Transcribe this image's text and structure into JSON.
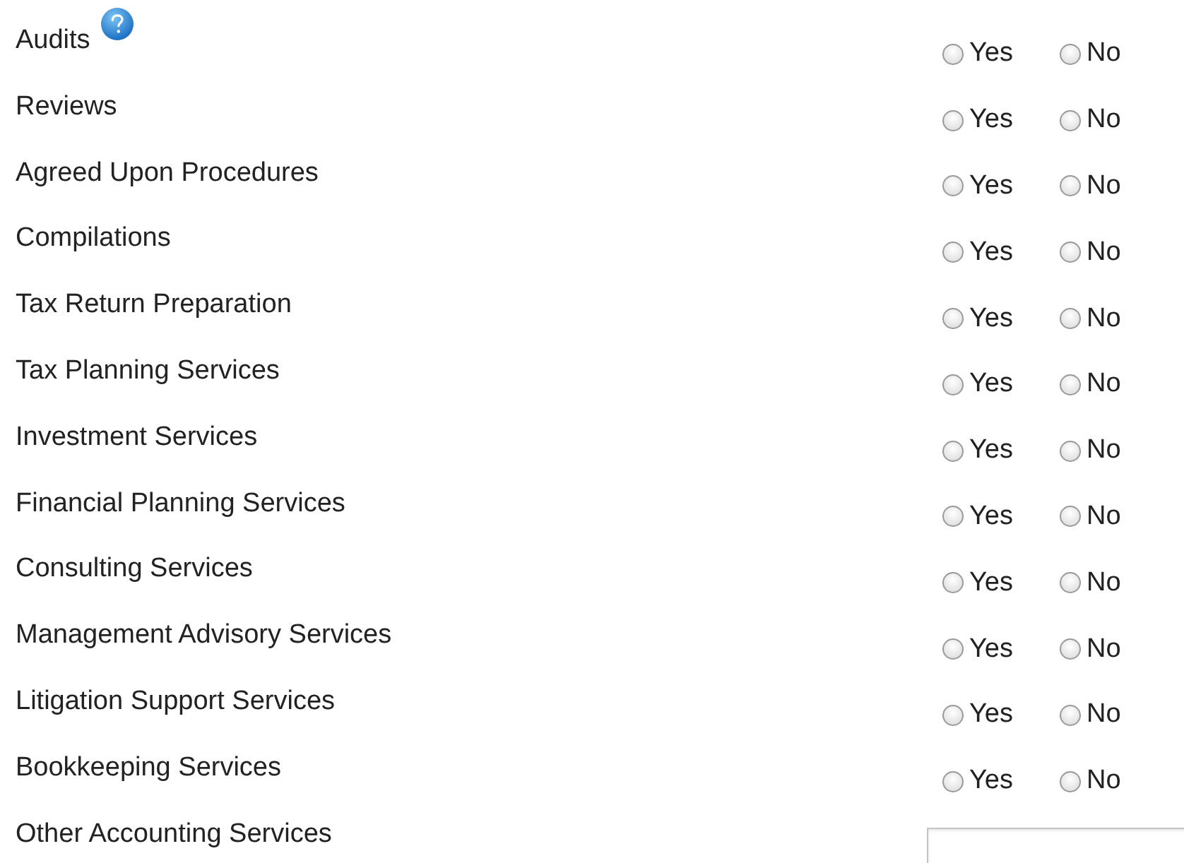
{
  "rows": [
    {
      "kind": "yes_no",
      "label": "Audits",
      "help": true,
      "options": [
        {
          "label": "Yes",
          "selected": false
        },
        {
          "label": "No",
          "selected": false
        }
      ]
    },
    {
      "kind": "yes_no",
      "label": "Reviews",
      "options": [
        {
          "label": "Yes",
          "selected": false
        },
        {
          "label": "No",
          "selected": false
        }
      ]
    },
    {
      "kind": "yes_no",
      "label": "Agreed Upon Procedures",
      "options": [
        {
          "label": "Yes",
          "selected": false
        },
        {
          "label": "No",
          "selected": false
        }
      ]
    },
    {
      "kind": "yes_no",
      "label": "Compilations",
      "options": [
        {
          "label": "Yes",
          "selected": false
        },
        {
          "label": "No",
          "selected": false
        }
      ]
    },
    {
      "kind": "yes_no",
      "label": "Tax Return Preparation",
      "options": [
        {
          "label": "Yes",
          "selected": false
        },
        {
          "label": "No",
          "selected": false
        }
      ]
    },
    {
      "kind": "yes_no",
      "label": "Tax Planning Services",
      "options": [
        {
          "label": "Yes",
          "selected": false
        },
        {
          "label": "No",
          "selected": false
        }
      ]
    },
    {
      "kind": "yes_no",
      "label": "Investment Services",
      "options": [
        {
          "label": "Yes",
          "selected": false
        },
        {
          "label": "No",
          "selected": false
        }
      ]
    },
    {
      "kind": "yes_no",
      "label": "Financial Planning Services",
      "options": [
        {
          "label": "Yes",
          "selected": false
        },
        {
          "label": "No",
          "selected": false
        }
      ]
    },
    {
      "kind": "yes_no",
      "label": "Consulting Services",
      "options": [
        {
          "label": "Yes",
          "selected": false
        },
        {
          "label": "No",
          "selected": false
        }
      ]
    },
    {
      "kind": "yes_no",
      "label": "Management Advisory Services",
      "options": [
        {
          "label": "Yes",
          "selected": false
        },
        {
          "label": "No",
          "selected": false
        }
      ]
    },
    {
      "kind": "yes_no",
      "label": "Litigation Support Services",
      "options": [
        {
          "label": "Yes",
          "selected": false
        },
        {
          "label": "No",
          "selected": false
        }
      ]
    },
    {
      "kind": "yes_no",
      "label": "Bookkeeping Services",
      "options": [
        {
          "label": "Yes",
          "selected": false
        },
        {
          "label": "No",
          "selected": false
        }
      ]
    },
    {
      "kind": "text",
      "label": "Other Accounting Services"
    }
  ]
}
